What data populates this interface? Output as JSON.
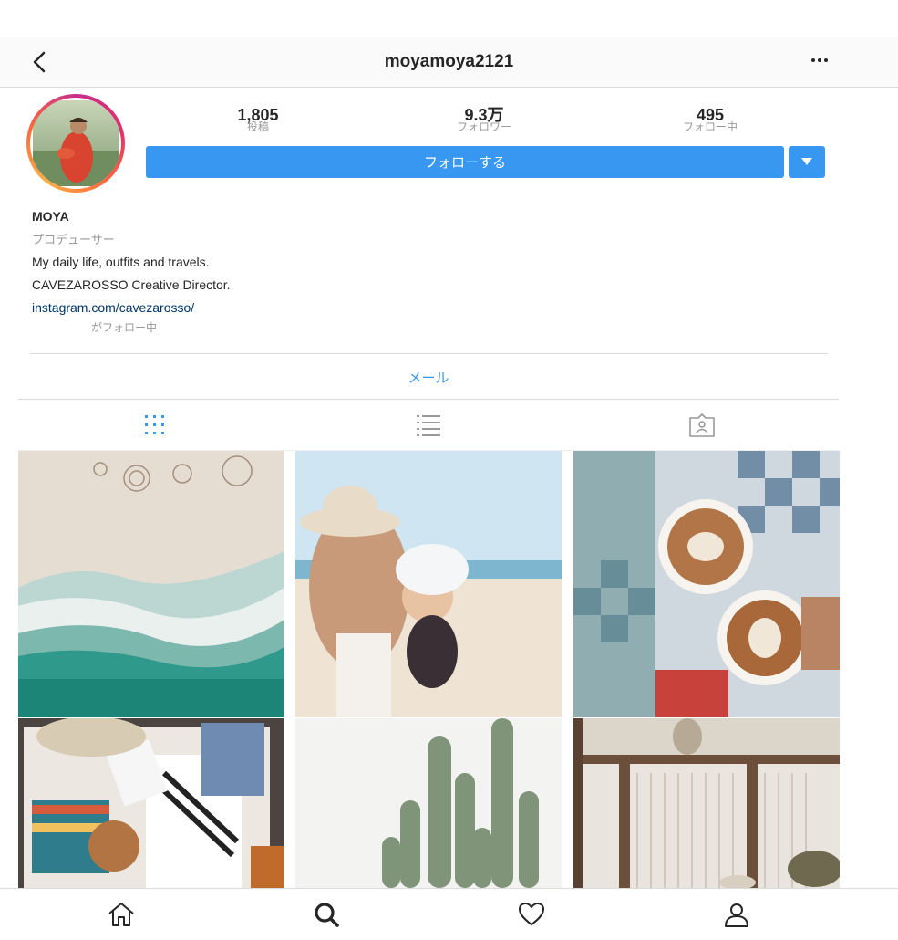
{
  "header": {
    "title": "moyamoya2121"
  },
  "stats": [
    {
      "value": "1,805",
      "label": "投稿"
    },
    {
      "value": "9.3万",
      "label": "フォロワー"
    },
    {
      "value": "495",
      "label": "フォロー中"
    }
  ],
  "follow_button": "フォローする",
  "bio": {
    "name": "MOYA",
    "category": "プロデューサー",
    "line1": "My daily life, outfits and travels.",
    "line2": "CAVEZAROSSO Creative Director.",
    "link": "instagram.com/cavezarosso/"
  },
  "followed_by": "がフォロー中",
  "contact_button": "メール",
  "tabs": [
    {
      "icon": "grid-icon",
      "active": true
    },
    {
      "icon": "list-icon",
      "active": false
    },
    {
      "icon": "tagged-icon",
      "active": false
    }
  ],
  "posts": [
    "aerial beach with ocean waves",
    "woman in hat holding baby at beach",
    "two cappuccinos over tiled floor",
    "open suitcase with packed clothes",
    "tall green cactus against white wall",
    "rustic pergola with white reed wall"
  ],
  "bottom_nav": [
    "home-icon",
    "search-icon",
    "heart-icon",
    "profile-icon"
  ],
  "colors": {
    "accent": "#3897f0",
    "link": "#003569",
    "muted": "#999999",
    "border": "#dbdbdb"
  }
}
